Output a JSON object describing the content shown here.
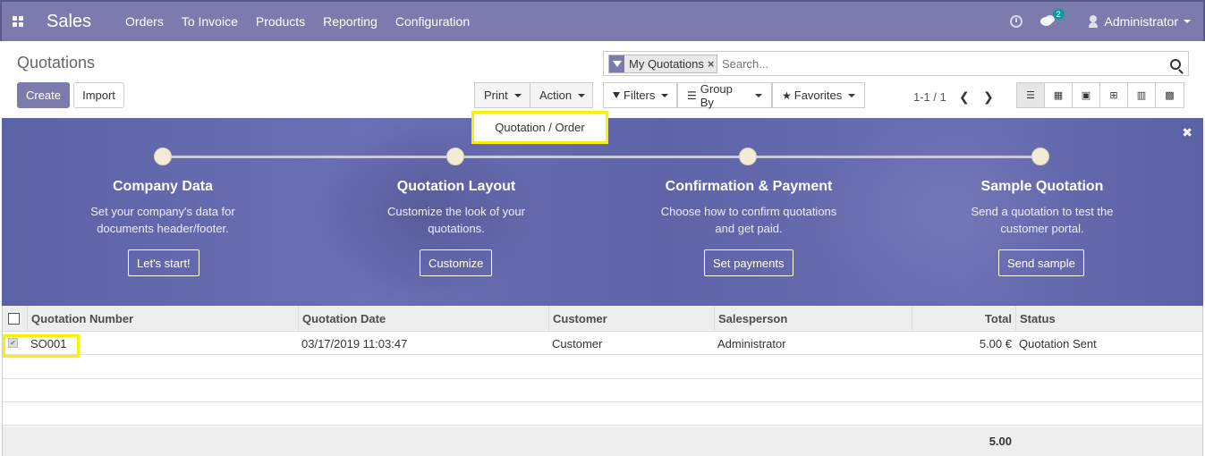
{
  "navbar": {
    "app_name": "Sales",
    "menu": [
      "Orders",
      "To Invoice",
      "Products",
      "Reporting",
      "Configuration"
    ],
    "chat_badge": "2",
    "user": "Administrator"
  },
  "control": {
    "title": "Quotations",
    "create_label": "Create",
    "import_label": "Import",
    "print_label": "Print",
    "action_label": "Action",
    "search": {
      "facet": "My Quotations",
      "placeholder": "Search..."
    },
    "filters_label": "Filters",
    "groupby_label": "Group By",
    "favorites_label": "Favorites",
    "pager": "1-1 / 1"
  },
  "print_menu": {
    "item": "Quotation / Order"
  },
  "banner": {
    "steps": [
      {
        "title": "Company Data",
        "desc1": "Set your company's data for",
        "desc2": "documents header/footer.",
        "button": "Let's start!"
      },
      {
        "title": "Quotation Layout",
        "desc1": "Customize the look of your",
        "desc2": "quotations.",
        "button": "Customize"
      },
      {
        "title": "Confirmation & Payment",
        "desc1": "Choose how to confirm quotations",
        "desc2": "and get paid.",
        "button": "Set payments"
      },
      {
        "title": "Sample Quotation",
        "desc1": "Send a quotation to test the",
        "desc2": "customer portal.",
        "button": "Send sample"
      }
    ]
  },
  "table": {
    "headers": [
      "Quotation Number",
      "Quotation Date",
      "Customer",
      "Salesperson",
      "Total",
      "Status"
    ],
    "rows": [
      {
        "number": "SO001",
        "date": "03/17/2019 11:03:47",
        "customer": "Customer",
        "salesperson": "Administrator",
        "total": "5.00 €",
        "status": "Quotation Sent"
      }
    ],
    "footer_total": "5.00"
  }
}
